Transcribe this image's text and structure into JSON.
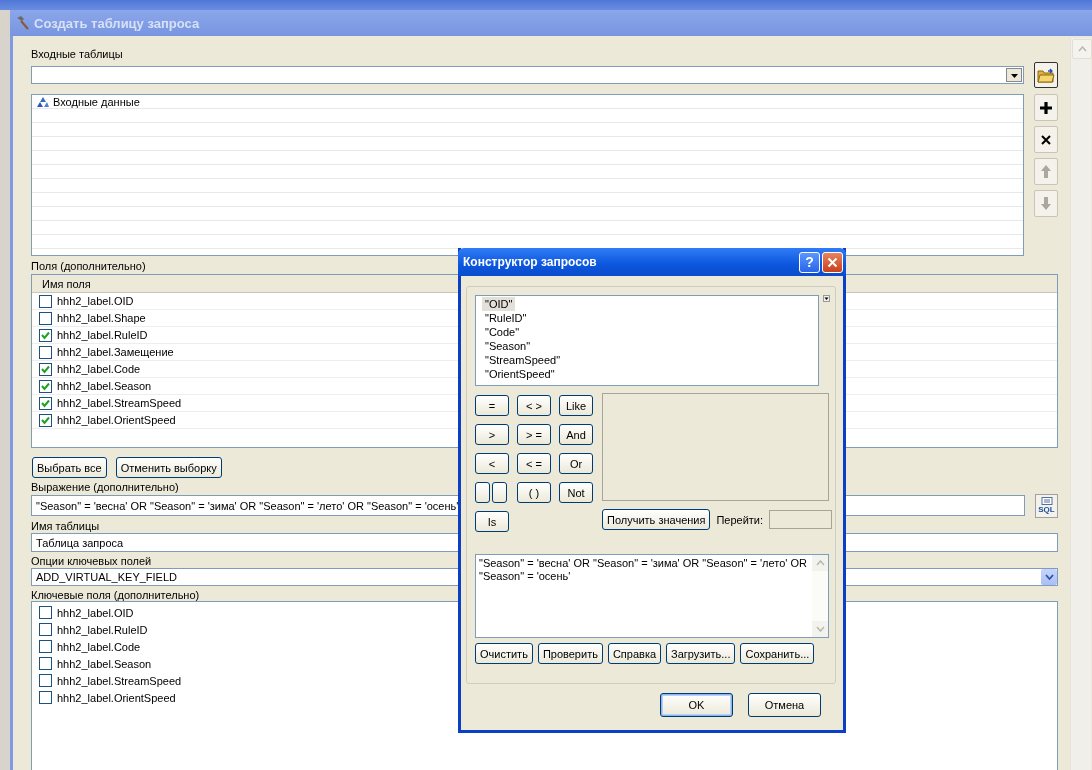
{
  "window": {
    "title": "Создать таблицу запроса"
  },
  "input_tables": {
    "label": "Входные таблицы"
  },
  "input_list": {
    "items": [
      {
        "label": "Входные данные"
      }
    ]
  },
  "fields": {
    "label": "Поля (дополнительно)",
    "column": "Имя поля",
    "rows": [
      {
        "name": "hhh2_label.OID",
        "checked": false
      },
      {
        "name": "hhh2_label.Shape",
        "checked": false
      },
      {
        "name": "hhh2_label.RuleID",
        "checked": true
      },
      {
        "name": "hhh2_label.Замещение",
        "checked": false
      },
      {
        "name": "hhh2_label.Code",
        "checked": true
      },
      {
        "name": "hhh2_label.Season",
        "checked": true
      },
      {
        "name": "hhh2_label.StreamSpeed",
        "checked": true
      },
      {
        "name": "hhh2_label.OrientSpeed",
        "checked": true
      }
    ]
  },
  "selection_buttons": [
    "Выбрать все",
    "Отменить выборку"
  ],
  "expression": {
    "label": "Выражение (дополнительно)",
    "value": "\"Season\" = 'весна' OR \"Season\" = 'зима' OR \"Season\" = 'лето' OR \"Season\" = 'осень'",
    "sql_button": "SQL"
  },
  "table_name": {
    "label": "Имя таблицы",
    "value": "Таблица запроса"
  },
  "key_options": {
    "label": "Опции ключевых полей",
    "value": "ADD_VIRTUAL_KEY_FIELD"
  },
  "key_fields": {
    "label": "Ключевые поля (дополнительно)",
    "rows": [
      {
        "name": "hhh2_label.OID",
        "checked": false
      },
      {
        "name": "hhh2_label.RuleID",
        "checked": false
      },
      {
        "name": "hhh2_label.Code",
        "checked": false
      },
      {
        "name": "hhh2_label.Season",
        "checked": false
      },
      {
        "name": "hhh2_label.StreamSpeed",
        "checked": false
      },
      {
        "name": "hhh2_label.OrientSpeed",
        "checked": false
      }
    ]
  },
  "dialog": {
    "title": "Конструктор запросов",
    "help": "?",
    "field_list": [
      {
        "label": "\"OID\"",
        "selected": true
      },
      {
        "label": "\"RuleID\"",
        "selected": false
      },
      {
        "label": "\"Code\"",
        "selected": false
      },
      {
        "label": "\"Season\"",
        "selected": false
      },
      {
        "label": "\"StreamSpeed\"",
        "selected": false
      },
      {
        "label": "\"OrientSpeed\"",
        "selected": false
      }
    ],
    "operators": [
      {
        "kind": "text",
        "label": "="
      },
      {
        "kind": "text",
        "label": "< >"
      },
      {
        "kind": "text",
        "label": "Like"
      },
      {
        "kind": "text",
        "label": ">"
      },
      {
        "kind": "text",
        "label": "> ="
      },
      {
        "kind": "text",
        "label": "And"
      },
      {
        "kind": "text",
        "label": "<"
      },
      {
        "kind": "text",
        "label": "< ="
      },
      {
        "kind": "text",
        "label": "Or"
      },
      {
        "kind": "pair"
      },
      {
        "kind": "text",
        "label": "( )"
      },
      {
        "kind": "text",
        "label": "Not"
      },
      {
        "kind": "text",
        "label": "Is"
      }
    ],
    "get_values_button": "Получить значения",
    "goto": {
      "label": "Перейти:"
    },
    "expression": "\"Season\" = 'весна' OR \"Season\" = 'зима' OR \"Season\" = 'лето' OR \"Season\" = 'осень'",
    "action_buttons": [
      "Очистить",
      "Проверить",
      "Справка",
      "Загрузить...",
      "Сохранить..."
    ],
    "buttons": [
      "OK",
      "Отмена"
    ]
  }
}
